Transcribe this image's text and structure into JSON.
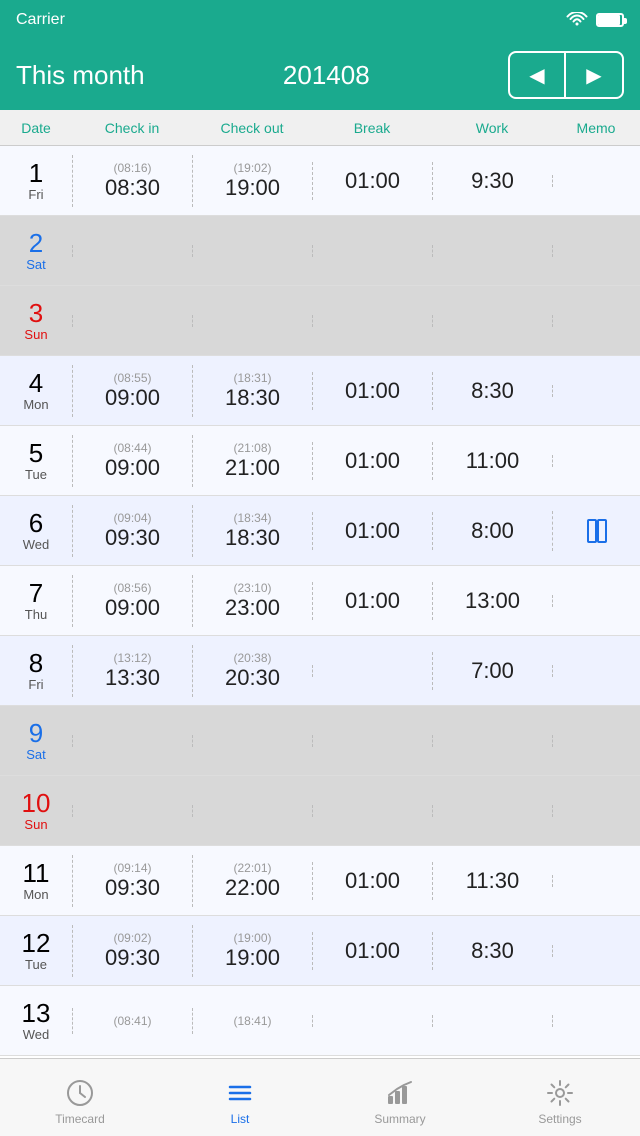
{
  "statusBar": {
    "carrier": "Carrier",
    "batteryFull": true
  },
  "header": {
    "title": "This month",
    "date": "201408",
    "prevLabel": "◀",
    "nextLabel": "▶"
  },
  "columns": {
    "date": "Date",
    "checkin": "Check in",
    "checkout": "Check out",
    "break": "Break",
    "work": "Work",
    "memo": "Memo"
  },
  "rows": [
    {
      "num": "1",
      "day": "Fri",
      "type": "weekday",
      "checkin_hint": "(08:16)",
      "checkin": "08:30",
      "checkout_hint": "(19:02)",
      "checkout": "19:00",
      "break": "01:00",
      "work": "9:30",
      "memo": ""
    },
    {
      "num": "2",
      "day": "Sat",
      "type": "sat",
      "checkin_hint": "",
      "checkin": "",
      "checkout_hint": "",
      "checkout": "",
      "break": "",
      "work": "",
      "memo": ""
    },
    {
      "num": "3",
      "day": "Sun",
      "type": "sun",
      "checkin_hint": "",
      "checkin": "",
      "checkout_hint": "",
      "checkout": "",
      "break": "",
      "work": "",
      "memo": ""
    },
    {
      "num": "4",
      "day": "Mon",
      "type": "weekday",
      "checkin_hint": "(08:55)",
      "checkin": "09:00",
      "checkout_hint": "(18:31)",
      "checkout": "18:30",
      "break": "01:00",
      "work": "8:30",
      "memo": ""
    },
    {
      "num": "5",
      "day": "Tue",
      "type": "weekday",
      "checkin_hint": "(08:44)",
      "checkin": "09:00",
      "checkout_hint": "(21:08)",
      "checkout": "21:00",
      "break": "01:00",
      "work": "11:00",
      "memo": ""
    },
    {
      "num": "6",
      "day": "Wed",
      "type": "weekday",
      "checkin_hint": "(09:04)",
      "checkin": "09:30",
      "checkout_hint": "(18:34)",
      "checkout": "18:30",
      "break": "01:00",
      "work": "8:00",
      "memo": "bookmark"
    },
    {
      "num": "7",
      "day": "Thu",
      "type": "weekday",
      "checkin_hint": "(08:56)",
      "checkin": "09:00",
      "checkout_hint": "(23:10)",
      "checkout": "23:00",
      "break": "01:00",
      "work": "13:00",
      "memo": ""
    },
    {
      "num": "8",
      "day": "Fri",
      "type": "weekday",
      "checkin_hint": "(13:12)",
      "checkin": "13:30",
      "checkout_hint": "(20:38)",
      "checkout": "20:30",
      "break": "",
      "work": "7:00",
      "memo": ""
    },
    {
      "num": "9",
      "day": "Sat",
      "type": "sat",
      "checkin_hint": "",
      "checkin": "",
      "checkout_hint": "",
      "checkout": "",
      "break": "",
      "work": "",
      "memo": ""
    },
    {
      "num": "10",
      "day": "Sun",
      "type": "sun",
      "checkin_hint": "",
      "checkin": "",
      "checkout_hint": "",
      "checkout": "",
      "break": "",
      "work": "",
      "memo": ""
    },
    {
      "num": "11",
      "day": "Mon",
      "type": "weekday",
      "checkin_hint": "(09:14)",
      "checkin": "09:30",
      "checkout_hint": "(22:01)",
      "checkout": "22:00",
      "break": "01:00",
      "work": "11:30",
      "memo": ""
    },
    {
      "num": "12",
      "day": "Tue",
      "type": "weekday",
      "checkin_hint": "(09:02)",
      "checkin": "09:30",
      "checkout_hint": "(19:00)",
      "checkout": "19:00",
      "break": "01:00",
      "work": "8:30",
      "memo": ""
    },
    {
      "num": "13",
      "day": "Wed",
      "type": "weekday",
      "checkin_hint": "(08:41)",
      "checkin": "",
      "checkout_hint": "(18:41)",
      "checkout": "",
      "break": "",
      "work": "",
      "memo": ""
    }
  ],
  "tabs": [
    {
      "id": "timecard",
      "label": "Timecard",
      "active": false
    },
    {
      "id": "list",
      "label": "List",
      "active": true
    },
    {
      "id": "summary",
      "label": "Summary",
      "active": false
    },
    {
      "id": "settings",
      "label": "Settings",
      "active": false
    }
  ]
}
